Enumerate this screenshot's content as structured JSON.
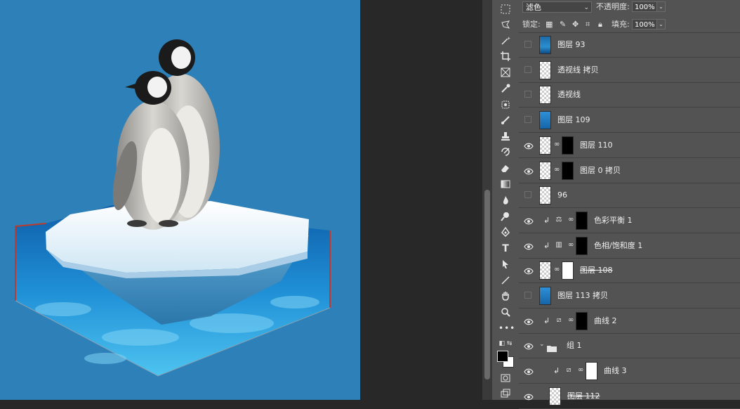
{
  "options_bar": {
    "blend_mode": "滤色",
    "opacity_label": "不透明度:",
    "opacity_value": "100%",
    "lock_label": "锁定:",
    "fill_label": "填充:",
    "fill_value": "100%"
  },
  "layers": [
    {
      "name": "图层 93",
      "visible": false,
      "thumb": "photo",
      "strike": false
    },
    {
      "name": "透视线 拷贝",
      "visible": false,
      "thumb": "checker",
      "strike": false
    },
    {
      "name": "透视线",
      "visible": false,
      "thumb": "checker",
      "strike": false
    },
    {
      "name": "图层 109",
      "visible": false,
      "thumb": "blue",
      "strike": false
    },
    {
      "name": "图层 110",
      "visible": true,
      "thumb": "checker",
      "mask": "black",
      "strike": false
    },
    {
      "name": "图层 0 拷贝",
      "visible": true,
      "thumb": "penguin",
      "mask": "black",
      "strike": false
    },
    {
      "name": "96",
      "visible": false,
      "thumb": "checker",
      "strike": false
    },
    {
      "name": "色彩平衡 1",
      "visible": true,
      "adjustment": "balance-icon",
      "mask": "black",
      "clipped": true,
      "strike": false
    },
    {
      "name": "色相/饱和度 1",
      "visible": true,
      "adjustment": "hue-sat-icon",
      "mask": "black",
      "clipped": true,
      "strike": false
    },
    {
      "name": "图层 108",
      "visible": true,
      "thumb": "checker",
      "mask": "white",
      "strike": true
    },
    {
      "name": "图层 113 拷贝",
      "visible": false,
      "thumb": "blue",
      "strike": false
    },
    {
      "name": "曲线 2",
      "visible": true,
      "adjustment": "curves-icon",
      "mask": "black",
      "clipped": true,
      "strike": false
    },
    {
      "name": "组 1",
      "visible": true,
      "group": true,
      "strike": false
    },
    {
      "name": "曲线 3",
      "visible": true,
      "adjustment": "curves-icon",
      "mask": "white",
      "clipped": true,
      "indent": true,
      "strike": false
    },
    {
      "name": "图层 112",
      "visible": true,
      "thumb": "checker",
      "indent": true,
      "strike": true
    }
  ],
  "tools": [
    "marquee-icon",
    "lasso-icon",
    "magic-wand-icon",
    "crop-icon",
    "frame-icon",
    "eyedropper-icon",
    "healing-icon",
    "brush-icon",
    "stamp-icon",
    "history-brush-icon",
    "eraser-icon",
    "gradient-icon",
    "blur-icon",
    "dodge-icon",
    "pen-icon",
    "type-icon",
    "path-select-icon",
    "line-icon",
    "hand-icon",
    "zoom-icon",
    "more-icon"
  ],
  "colors": {
    "canvas_bg": "#2e80b8",
    "panel_bg": "#535353",
    "foreground": "#000000",
    "background": "#ffffff"
  }
}
